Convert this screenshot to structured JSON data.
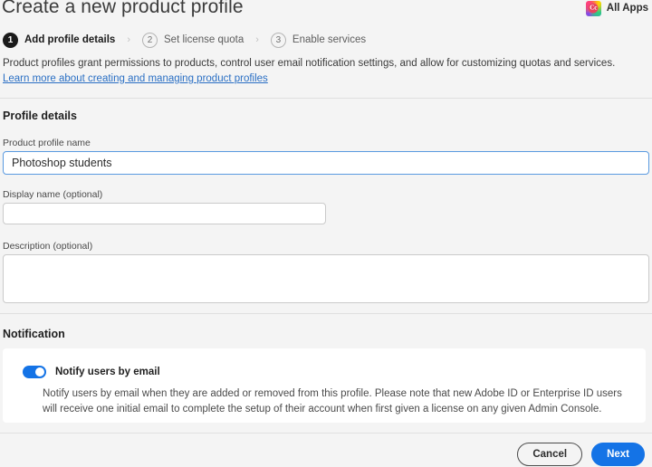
{
  "header": {
    "title": "Create a new product profile",
    "all_apps": {
      "label": "All Apps",
      "icon": "creative-cloud-icon",
      "badge": "Cc"
    }
  },
  "stepper": {
    "separator": "›",
    "steps": [
      {
        "number": "1",
        "label": "Add profile details",
        "state": "active"
      },
      {
        "number": "2",
        "label": "Set license quota",
        "state": "inactive"
      },
      {
        "number": "3",
        "label": "Enable services",
        "state": "inactive"
      }
    ]
  },
  "intro": {
    "text": "Product profiles grant permissions to products, control user email notification settings, and allow for customizing quotas and services.",
    "link": "Learn more about creating and managing product profiles"
  },
  "profile_section": {
    "title": "Profile details",
    "fields": {
      "product_profile_name": {
        "label": "Product profile name",
        "value": "Photoshop students",
        "placeholder": ""
      },
      "display_name": {
        "label": "Display name (optional)",
        "value": "",
        "placeholder": ""
      },
      "description": {
        "label": "Description (optional)",
        "value": "",
        "placeholder": ""
      }
    }
  },
  "notification_section": {
    "title": "Notification",
    "toggle": {
      "label": "Notify users by email",
      "state": "on"
    },
    "body": "Notify users by email when they are added or removed from this profile. Please note that new Adobe ID or Enterprise ID users will receive one initial email to complete the setup of their account when first given a license on any given Admin Console."
  },
  "footer": {
    "cancel_label": "Cancel",
    "next_label": "Next"
  },
  "colors": {
    "accent_blue": "#1473e6",
    "link_blue": "#2a6fc4",
    "focus_border": "#5a9ae0",
    "page_background": "#f4f4f4",
    "card_background": "#ffffff",
    "divider": "#e0e0e0",
    "active_step": "#1a1a1a"
  }
}
